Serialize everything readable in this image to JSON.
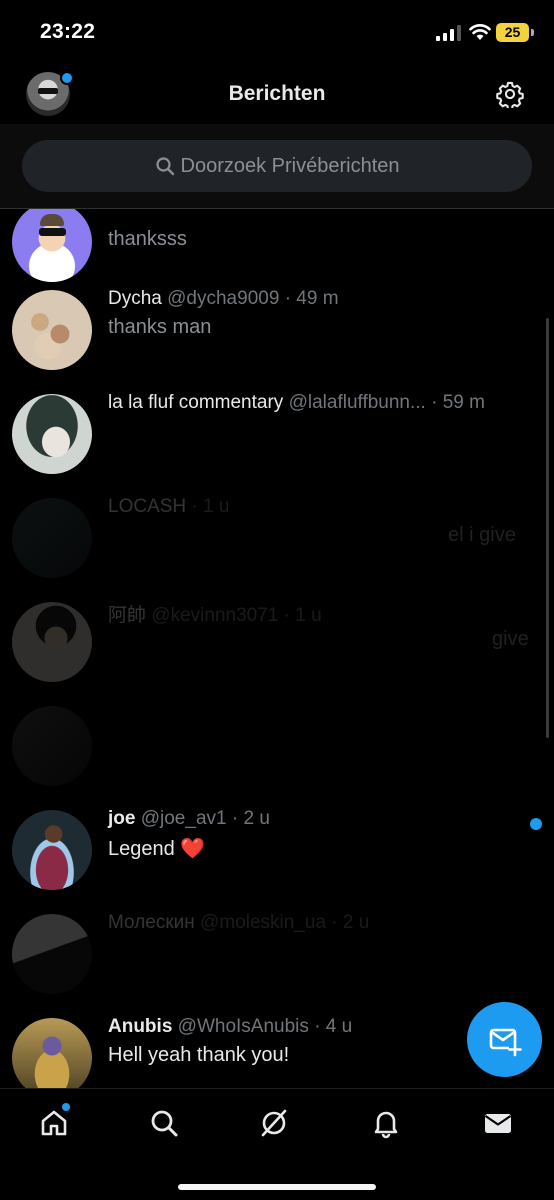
{
  "status_bar": {
    "time": "23:22",
    "battery": "25"
  },
  "header": {
    "title": "Berichten"
  },
  "search": {
    "placeholder": "Doorzoek Privéberichten"
  },
  "conversations": [
    {
      "name": "",
      "handle": "",
      "time": "",
      "preview": "thanksss",
      "unread": false,
      "faded": false
    },
    {
      "name": "Dycha",
      "handle": "@dycha9009",
      "time": "49 m",
      "preview": "thanks man",
      "unread": false,
      "faded": false
    },
    {
      "name": "la la fluf commentary",
      "handle": "@lalafluffbunn...",
      "time": "59 m",
      "preview": "",
      "unread": false,
      "faded": false
    },
    {
      "name": "LOCASH",
      "handle": "",
      "time": "1 u",
      "preview": "el i give",
      "unread": false,
      "faded": true
    },
    {
      "name": "阿帥",
      "handle": "@kevinnn3071",
      "time": "1 u",
      "preview": "give",
      "unread": false,
      "faded": true
    },
    {
      "name": "",
      "handle": "",
      "time": "",
      "preview": "",
      "unread": false,
      "faded": true
    },
    {
      "name": "joe",
      "handle": "@joe_av1",
      "time": "2 u",
      "preview": "Legend",
      "preview_emoji": "❤️",
      "unread": true,
      "faded": false
    },
    {
      "name": "Молескин",
      "handle": "@moleskin_ua",
      "time": "2 u",
      "preview": "",
      "unread": false,
      "faded": true
    },
    {
      "name": "Anubis",
      "handle": "@WhoIsAnubis",
      "time": "4 u",
      "preview": "Hell yeah thank you!",
      "unread": true,
      "faded": false
    }
  ],
  "separator": "·",
  "tabs": [
    {
      "name": "home",
      "active": true
    },
    {
      "name": "search",
      "active": false
    },
    {
      "name": "grok",
      "active": false
    },
    {
      "name": "notifications",
      "active": false
    },
    {
      "name": "messages",
      "active": false
    }
  ],
  "colors": {
    "accent": "#1d9bf0",
    "background": "#000000",
    "text": "#e7e9ea",
    "muted": "#71767b",
    "battery": "#f2d33e"
  }
}
